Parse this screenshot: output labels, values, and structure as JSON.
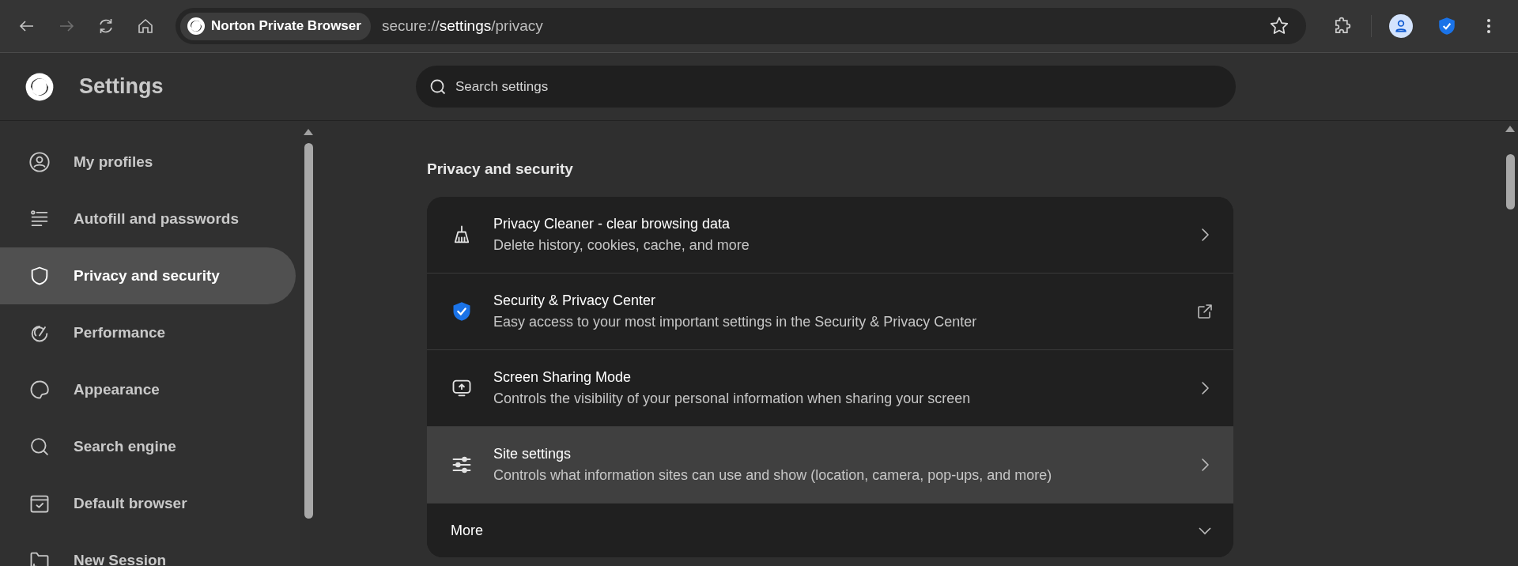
{
  "toolbar": {
    "site_chip": "Norton Private Browser",
    "url": {
      "scheme": "secure://",
      "host": "settings",
      "path": "/privacy"
    }
  },
  "header": {
    "title": "Settings",
    "search": {
      "placeholder": "Search settings"
    }
  },
  "sidebar": {
    "items": [
      {
        "label": "My profiles",
        "selected": false
      },
      {
        "label": "Autofill and passwords",
        "selected": false
      },
      {
        "label": "Privacy and security",
        "selected": true
      },
      {
        "label": "Performance",
        "selected": false
      },
      {
        "label": "Appearance",
        "selected": false
      },
      {
        "label": "Search engine",
        "selected": false
      },
      {
        "label": "Default browser",
        "selected": false
      },
      {
        "label": "New Session",
        "selected": false
      }
    ]
  },
  "section": {
    "title": "Privacy and security",
    "rows": [
      {
        "title": "Privacy Cleaner - clear browsing data",
        "subtitle": "Delete history, cookies, cache, and more",
        "hovered": false
      },
      {
        "title": "Security & Privacy Center",
        "subtitle": "Easy access to your most important settings in the Security & Privacy Center",
        "hovered": false
      },
      {
        "title": "Screen Sharing Mode",
        "subtitle": "Controls the visibility of your personal information when sharing your screen",
        "hovered": false
      },
      {
        "title": "Site settings",
        "subtitle": "Controls what information sites can use and show (location, camera, pop-ups, and more)",
        "hovered": true
      }
    ],
    "more": {
      "label": "More",
      "expanded": false
    }
  }
}
